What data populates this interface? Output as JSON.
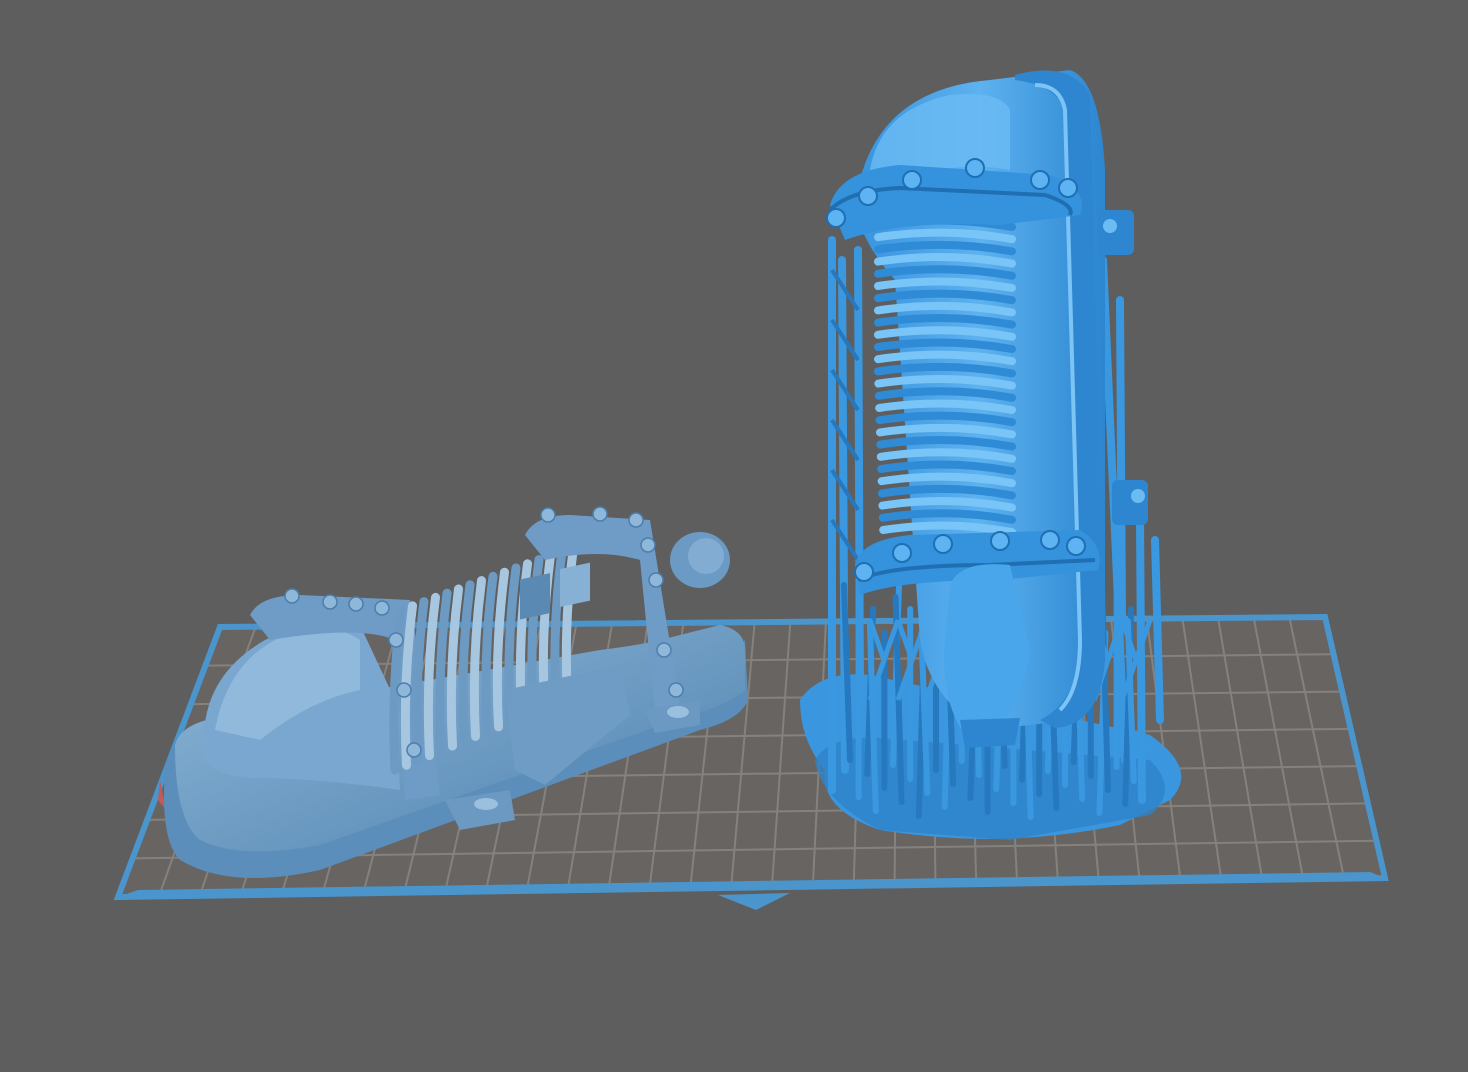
{
  "app": {
    "view": "slicer-3d-viewport"
  },
  "viewport": {
    "background": "#5e5e5e",
    "build_plate": {
      "fill": "#686462",
      "grid_color": "#85817d",
      "border_color": "#4a95cc",
      "front_notch": true
    },
    "models": [
      {
        "id": "model-lying",
        "state": "unselected",
        "description_icon": "reactor-cylinder-lying",
        "color": "#5b8eba",
        "supports": false
      },
      {
        "id": "model-upright",
        "state": "selected",
        "description_icon": "reactor-cylinder-upright",
        "color": "#3a98e0",
        "supports": true
      }
    ]
  }
}
